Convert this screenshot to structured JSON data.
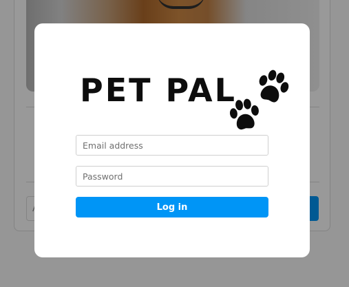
{
  "background": {
    "comment_placeholder": "A",
    "post_button_label": ""
  },
  "modal": {
    "logo_text": "PET PAL",
    "logo_icon": "paw-print-icon",
    "email": {
      "placeholder": "Email address",
      "value": ""
    },
    "password": {
      "placeholder": "Password",
      "value": ""
    },
    "login_label": "Log in"
  },
  "colors": {
    "accent": "#0095f6",
    "overlay": "rgba(0,0,0,0.40)",
    "logo": "#0d0d0d"
  }
}
